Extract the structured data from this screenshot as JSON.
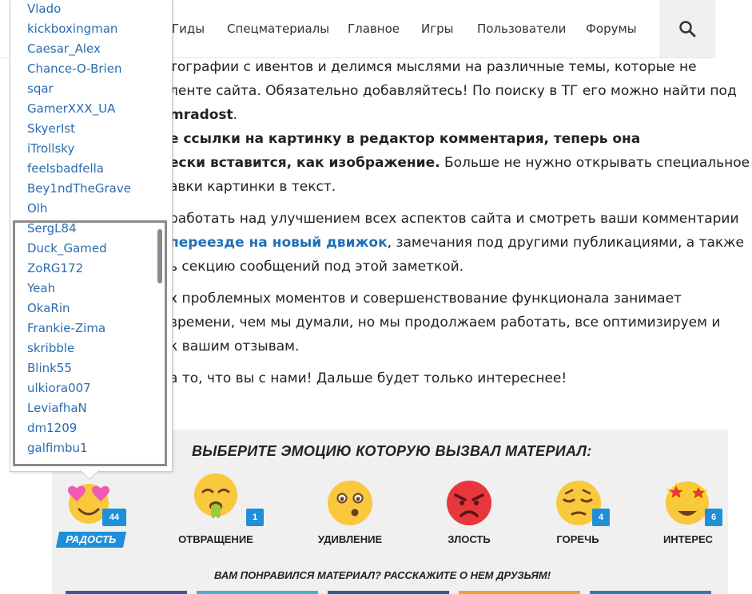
{
  "nav": {
    "items": [
      "Гиды",
      "Спецматериалы",
      "Главное",
      "Игры",
      "Пользователи",
      "Форумы"
    ],
    "search_icon": "search-icon"
  },
  "article": {
    "l1": "тографии с ивентов и делимся мыслями на различные темы, которые не",
    "l2": "ленте сайта. Обязательно добавляйтесь! По поиску в ТГ его можно найти под",
    "l3": "mradost",
    "l3_end": ".",
    "l4": "е ссылки на картинку в редактор комментария, теперь она",
    "l5_bold": "ески вставится, как изображение.",
    "l5_rest": " Больше не нужно открывать специальное",
    "l6": "авки картинки в текст.",
    "l7": "работать над улучшением всех аспектов сайта и смотреть ваши комментарии",
    "l8_link": "переезде на новый движок",
    "l8_rest": ", замечания под другими публикациями, а также",
    "l9": "ь секцию сообщений под этой заметкой.",
    "l10": "х проблемных моментов и совершенствование функционала занимает",
    "l11": "времени, чем мы думали, но мы продолжаем работать, все оптимизируем и",
    "l12": "к вашим отзывам.",
    "l13": "а то, что вы с нами! Дальше будет только интереснее!"
  },
  "dropdown": {
    "users": [
      "Vlado",
      "kickboxingman",
      "Caesar_Alex",
      "Chance-O-Brien",
      "sqar",
      "GamerXXX_UA",
      "SkyerIst",
      "iTrollsky",
      "feelsbadfella",
      "Bey1ndTheGrave",
      "Olh",
      "SergL84",
      "Duck_Gamed",
      "ZoRG172",
      "Yeah",
      "OkaRin",
      "Frankie-Zima",
      "skribble",
      "Blink55",
      "ulkiora007",
      "LeviafhaN",
      "dm1209",
      "galfimbu1"
    ]
  },
  "emotions": {
    "title": "ВЫБЕРИТЕ ЭМОЦИЮ КОТОРУЮ ВЫЗВАЛ МАТЕРИАЛ:",
    "items": [
      {
        "label": "РАДОСТЬ",
        "count": "44",
        "icon": "heart-eyes-emoji-icon"
      },
      {
        "label": "ОТВРАЩЕНИЕ",
        "count": "1",
        "icon": "disgust-emoji-icon"
      },
      {
        "label": "УДИВЛЕНИЕ",
        "count": "",
        "icon": "surprised-emoji-icon"
      },
      {
        "label": "ЗЛОСТЬ",
        "count": "",
        "icon": "angry-emoji-icon"
      },
      {
        "label": "ГОРЕЧЬ",
        "count": "4",
        "icon": "sad-emoji-icon"
      },
      {
        "label": "ИНТЕРЕС",
        "count": "6",
        "icon": "star-eyes-emoji-icon"
      }
    ],
    "share": "ВАМ ПОНРАВИЛСЯ МАТЕРИАЛ? РАССКАЖИТЕ О НЕМ ДРУЗЬЯМ!"
  },
  "colors": {
    "accent": "#1e8fd8",
    "link": "#2a6cb0",
    "panel_bg": "#f0f0f0"
  }
}
